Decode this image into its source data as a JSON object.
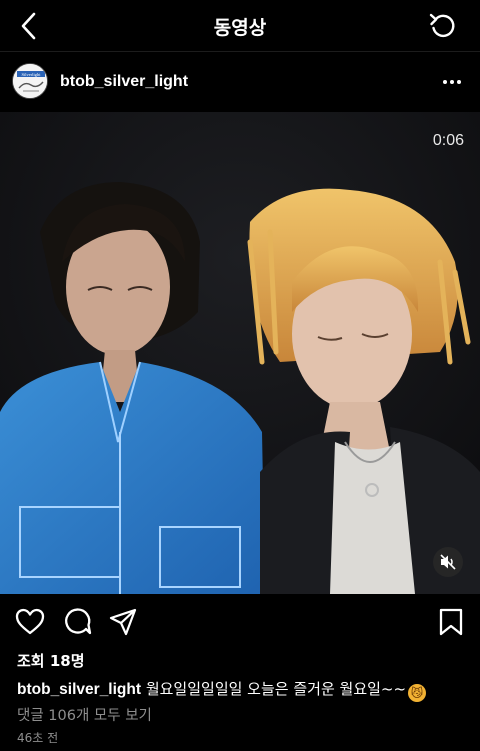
{
  "topbar": {
    "title": "동영상",
    "back_icon": "chevron-left-icon",
    "refresh_icon": "refresh-icon"
  },
  "post": {
    "username": "btob_silver_light",
    "avatar_text": "Silverlight",
    "more_icon": "more-horizontal-icon",
    "video_time": "0:06",
    "mute_icon": "speaker-muted-icon"
  },
  "actions": {
    "like_icon": "heart-icon",
    "comment_icon": "comment-icon",
    "share_icon": "send-icon",
    "save_icon": "bookmark-icon"
  },
  "stats": {
    "views": "조회 18명"
  },
  "caption": {
    "username": "btob_silver_light",
    "text": "월요일일일일일 오늘은 즐거운 월요일~~",
    "emoji": "😼"
  },
  "comments_link": "댓글 106개 모두 보기",
  "timestamp": "46초 전",
  "colors": {
    "background": "#000000",
    "text": "#ffffff",
    "muted_text": "#8e8e8e"
  }
}
